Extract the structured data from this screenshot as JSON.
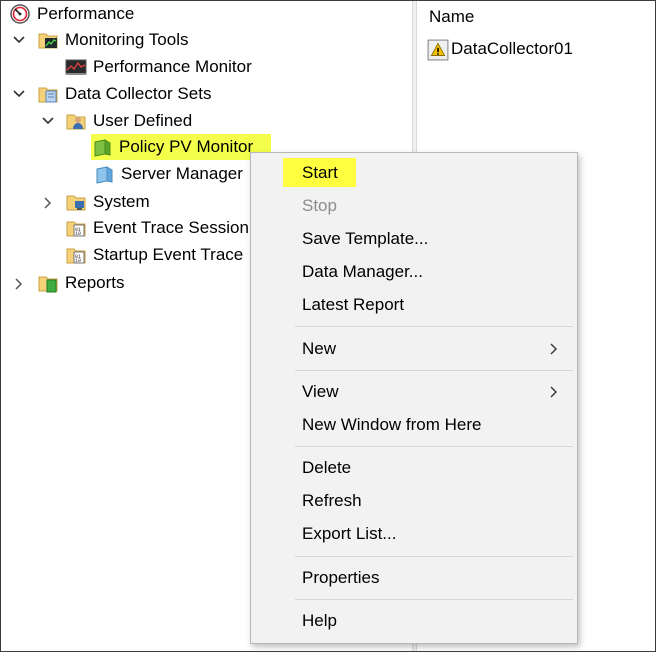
{
  "tree": {
    "performance": "Performance",
    "monitoring_tools": "Monitoring Tools",
    "performance_monitor": "Performance Monitor",
    "data_collector_sets": "Data Collector Sets",
    "user_defined": "User Defined",
    "policy_pv_monitor": "Policy PV Monitor",
    "server_manager": "Server Manager",
    "system": "System",
    "event_trace_sessions": "Event Trace Session",
    "startup_event_trace": "Startup Event Trace",
    "reports": "Reports"
  },
  "list": {
    "column_name": "Name",
    "items": [
      "DataCollector01"
    ]
  },
  "context_menu": {
    "start": "Start",
    "stop": "Stop",
    "save_template": "Save Template...",
    "data_manager": "Data Manager...",
    "latest_report": "Latest Report",
    "new": "New",
    "view": "View",
    "new_window": "New Window from Here",
    "delete": "Delete",
    "refresh": "Refresh",
    "export_list": "Export List...",
    "properties": "Properties",
    "help": "Help"
  },
  "colors": {
    "highlight": "#ffff3f",
    "disabled_text": "#8c8c8c",
    "menu_background": "#f2f2f2"
  }
}
